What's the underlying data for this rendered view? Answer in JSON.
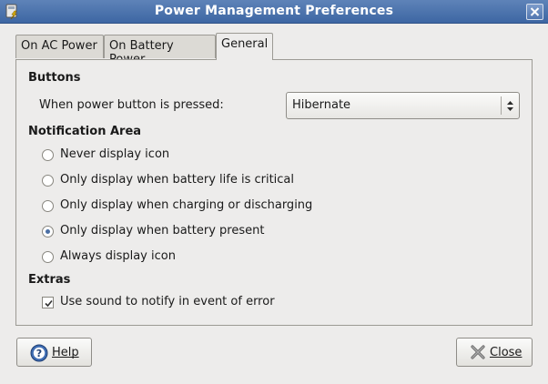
{
  "window": {
    "title": "Power Management Preferences",
    "app_icon": "power-prefs-icon",
    "close_icon": "close-icon"
  },
  "tabs": [
    {
      "label": "On AC Power",
      "active": false
    },
    {
      "label": "On Battery Power",
      "active": false
    },
    {
      "label": "General",
      "active": true
    }
  ],
  "buttons_section": {
    "heading": "Buttons",
    "power_button_label": "When power button is pressed:",
    "power_button_value": "Hibernate"
  },
  "notification_section": {
    "heading": "Notification Area",
    "options": [
      {
        "label": "Never display icon",
        "checked": false
      },
      {
        "label": "Only display when battery life is critical",
        "checked": false
      },
      {
        "label": "Only display when charging or discharging",
        "checked": false
      },
      {
        "label": "Only display when battery present",
        "checked": true
      },
      {
        "label": "Always display icon",
        "checked": false
      }
    ]
  },
  "extras_section": {
    "heading": "Extras",
    "sound_label": "Use sound to notify in event of error",
    "sound_checked": true
  },
  "footer": {
    "help_label": "Help",
    "help_icon": "help-icon",
    "close_label": "Close",
    "close_icon": "close-x-icon"
  },
  "colors": {
    "titlebar": "#4a72ad",
    "background": "#edeceb",
    "radio_accent": "#4b6fa5"
  }
}
